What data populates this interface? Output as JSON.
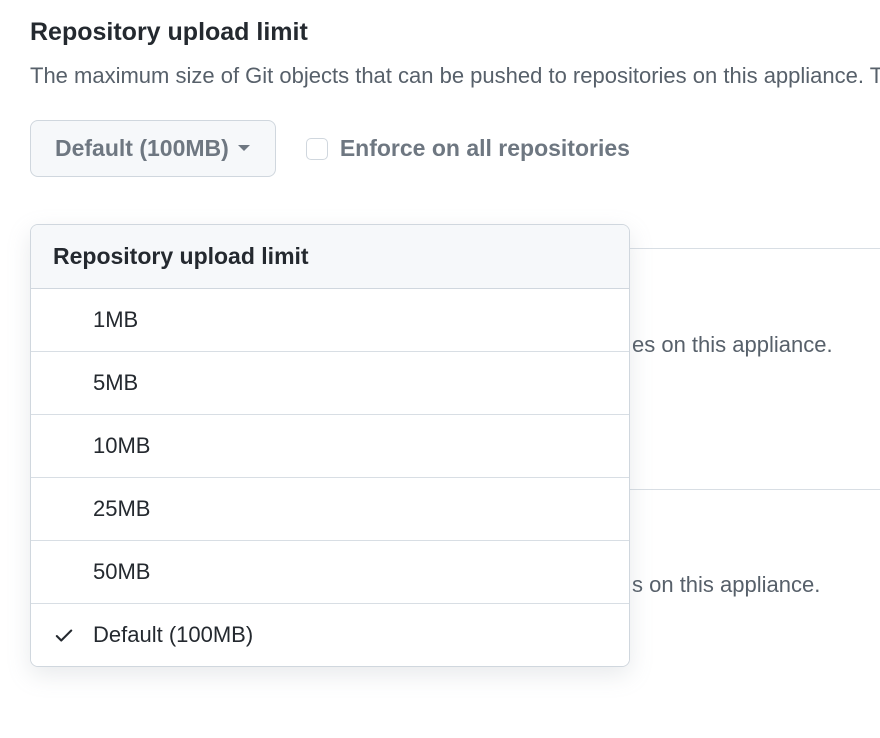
{
  "section": {
    "heading": "Repository upload limit",
    "description": "The maximum size of Git objects that can be pushed to repositories on this appliance. To improve performance, consider other options (e.g. git-lfs) before increasing this value."
  },
  "dropdown": {
    "button_label": "Default (100MB)",
    "menu_title": "Repository upload limit",
    "options": [
      {
        "label": "1MB",
        "selected": false
      },
      {
        "label": "5MB",
        "selected": false
      },
      {
        "label": "10MB",
        "selected": false
      },
      {
        "label": "25MB",
        "selected": false
      },
      {
        "label": "50MB",
        "selected": false
      },
      {
        "label": "Default (100MB)",
        "selected": true
      }
    ]
  },
  "checkbox": {
    "label": "Enforce on all repositories",
    "checked": false
  },
  "background": {
    "text1": "es on this appliance.",
    "text2": "s on this appliance."
  }
}
